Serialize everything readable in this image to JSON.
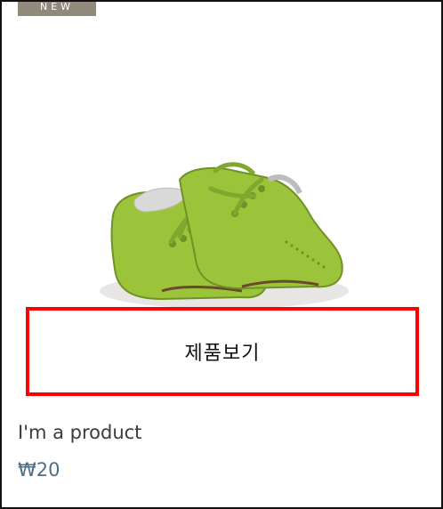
{
  "product": {
    "badge": "NEW",
    "quick_view_label": "제품보기",
    "name": "I'm a product",
    "price": "₩20"
  },
  "colors": {
    "badge_bg": "#8f8a7b",
    "shoe": "#9cc23a",
    "highlight_border": "#ff0000",
    "price_text": "#4f6f86"
  }
}
